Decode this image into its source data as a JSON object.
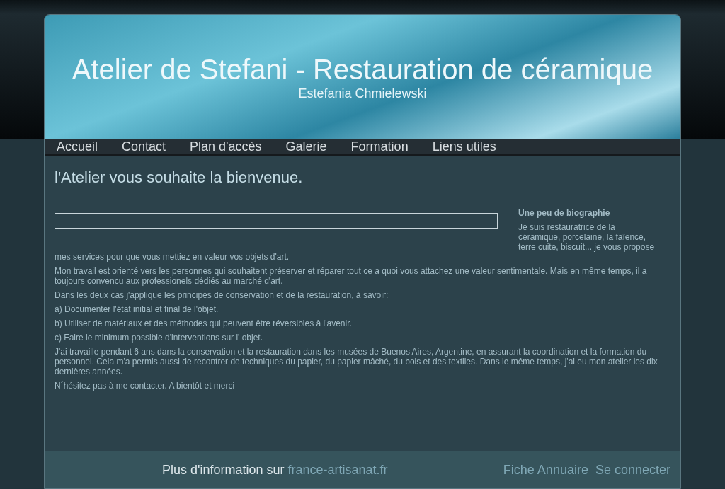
{
  "header": {
    "title": "Atelier de Stefani - Restauration de céramique",
    "subtitle": "Estefania Chmielewski"
  },
  "nav": [
    {
      "label": "Accueil"
    },
    {
      "label": "Contact"
    },
    {
      "label": "Plan d'accès"
    },
    {
      "label": "Galerie"
    },
    {
      "label": "Formation"
    },
    {
      "label": "Liens utiles"
    }
  ],
  "page_title": "l'Atelier vous souhaite la bienvenue.",
  "bio_heading": "Une peu de biographie",
  "paragraphs": [
    "Je suis restauratrice de la céramique, porcelaine, la faïence, terre cuite, biscuit... je vous propose mes services pour que vous mettiez en valeur vos objets d'art.",
    "Mon travail est orienté vers les personnes qui souhaitent préserver et réparer tout ce a quoi vous attachez une valeur sentimentale. Mais en même temps, il a toujours convencu aux professionels dédiés au marché d'art.",
    "Dans les deux cas j'applique les principes de conservation et de la restauration, à savoir:",
    "a) Documenter l'état initial et final de l'objet.",
    "b) Utiliser de matériaux et des méthodes qui peuvent être réversibles à l'avenir.",
    "c) Faire le minimum possible d'interventions sur l' objet.",
    "J'ai travaille pendant 6 ans dans la conservation et la restauration dans les musées de Buenos Aires, Argentine, en assurant la coordination et la formation du personnel. Cela m'a permis aussi de recontrer de techniques du papier, du papier mâché, du bois et des textiles. Dans le même temps, j'ai eu mon atelier les dix dernières années.",
    "N´hésitez pas à me contacter. A bientôt et merci"
  ],
  "footer": {
    "text": "Plus d'information sur",
    "link": "france-artisanat.fr",
    "links": [
      "Fiche Annuaire",
      "Se connecter"
    ]
  }
}
